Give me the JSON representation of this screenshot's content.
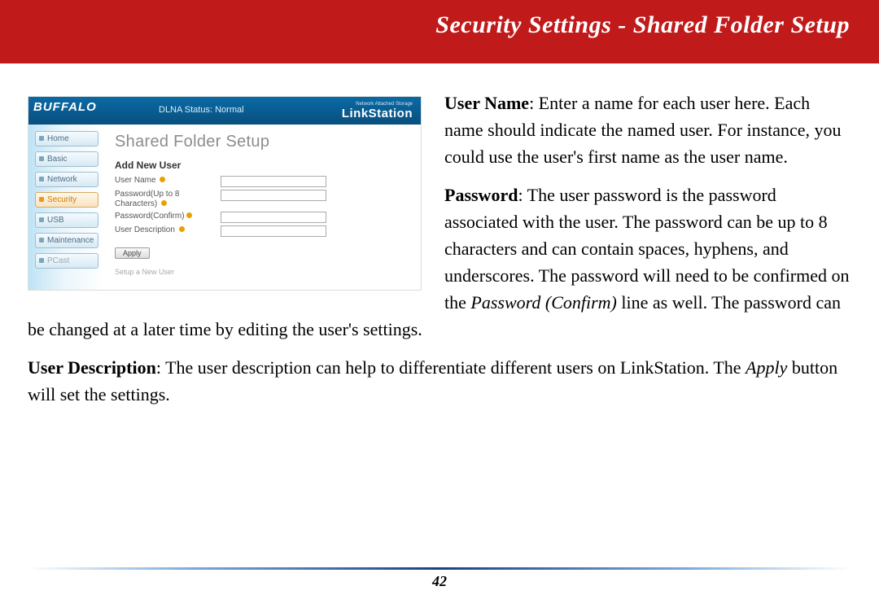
{
  "header": {
    "title": "Security Settings - Shared Folder Setup"
  },
  "screenshot": {
    "brand": "BUFFALO",
    "dlna_status": "DLNA Status: Normal",
    "product_small": "Network Attached Storage",
    "product": "LinkStation",
    "sidebar": {
      "items": [
        {
          "label": "Home",
          "active": false
        },
        {
          "label": "Basic",
          "active": false
        },
        {
          "label": "Network",
          "active": false
        },
        {
          "label": "Security",
          "active": true
        },
        {
          "label": "USB",
          "active": false
        },
        {
          "label": "Maintenance",
          "active": false
        },
        {
          "label": "PCast",
          "active": false,
          "dim": true
        }
      ]
    },
    "panel": {
      "title": "Shared Folder Setup",
      "subtitle": "Add New User",
      "rows": [
        {
          "label": "User Name"
        },
        {
          "label": "Password(Up to 8 Characters)"
        },
        {
          "label": "Password(Confirm)"
        },
        {
          "label": "User Description"
        }
      ],
      "apply_label": "Apply",
      "setup_link": "Setup a New User"
    }
  },
  "body": {
    "p1_lead": "User Name",
    "p1_text": ":  Enter a name for each user here.  Each name should indicate the named user.  For instance, you could use the user's first name as the user name.",
    "p2_lead": "Password",
    "p2_a": ":  The user password is the password associated with the user.  The password can be up to 8 characters and can contain spaces, hyphens, and underscores.  The password will need to be confirmed on the ",
    "p2_ital": "Password (Confirm)",
    "p2_b": " line as well.  The password can be changed at a later time by editing the user's settings.",
    "p3_lead": "User Description",
    "p3_a": ":  The user description can help to differentiate different users on LinkStation.  The ",
    "p3_ital": "Apply",
    "p3_b": " button will set the settings."
  },
  "page_number": "42"
}
